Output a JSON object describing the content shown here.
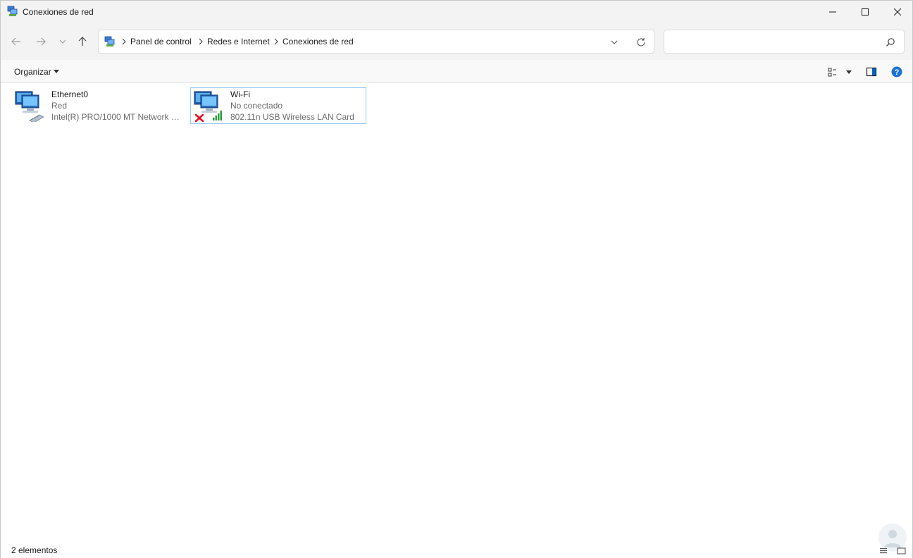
{
  "window": {
    "title": "Conexiones de red"
  },
  "address": {
    "breadcrumbs": [
      "Panel de control",
      "Redes e Internet",
      "Conexiones de red"
    ],
    "search_placeholder": ""
  },
  "commandbar": {
    "organize_label": "Organizar"
  },
  "connections": [
    {
      "name": "Ethernet0",
      "status": "Red",
      "device": "Intel(R) PRO/1000 MT Network C...",
      "icon": "ethernet-adapter-icon",
      "selected": false
    },
    {
      "name": "Wi-Fi",
      "status": "No conectado",
      "device": "802.11n USB Wireless LAN Card",
      "icon": "wifi-adapter-disconnected-icon",
      "selected": true
    }
  ],
  "statusbar": {
    "count": "2 elementos"
  },
  "colors": {
    "accent": "#0067c0",
    "selection_border": "#99c9ef",
    "error_red": "#e81123",
    "signal_green": "#2e9e3c"
  }
}
